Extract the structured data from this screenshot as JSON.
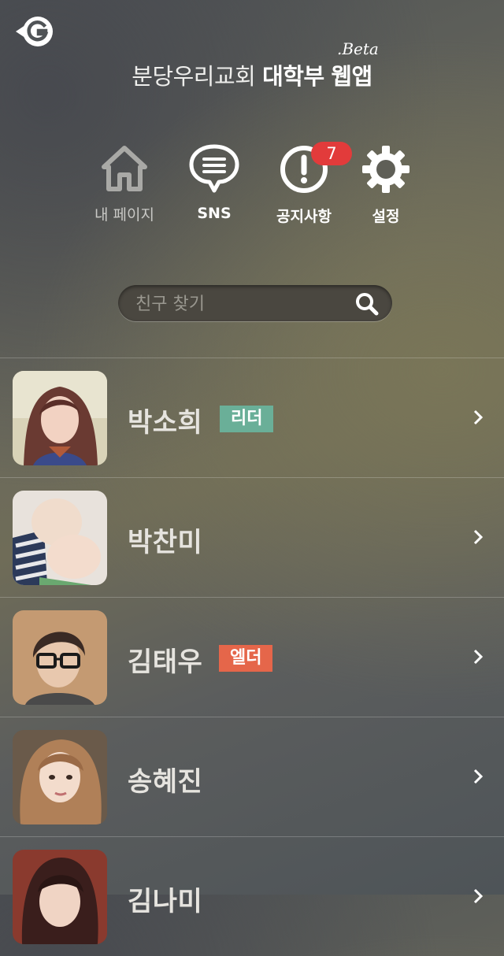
{
  "header": {
    "title_light": "분당우리교회",
    "title_bold_1": "대학부",
    "title_bold_2": "웹앱",
    "beta": ".Beta"
  },
  "menu": [
    {
      "label": "내 페이지",
      "icon": "home-icon"
    },
    {
      "label": "SNS",
      "icon": "chat-bubble-icon"
    },
    {
      "label": "공지사항",
      "icon": "alert-icon",
      "badge": "7"
    },
    {
      "label": "설정",
      "icon": "gear-icon"
    }
  ],
  "search": {
    "placeholder": "친구 찾기",
    "value": ""
  },
  "members": [
    {
      "name": "박소희",
      "tag": "리더",
      "tag_color": "#6aaf98"
    },
    {
      "name": "박찬미",
      "tag": "",
      "tag_color": ""
    },
    {
      "name": "김태우",
      "tag": "엘더",
      "tag_color": "#e5664a"
    },
    {
      "name": "송혜진",
      "tag": "",
      "tag_color": ""
    },
    {
      "name": "김나미",
      "tag": "",
      "tag_color": ""
    }
  ],
  "colors": {
    "badge": "#e23b3b",
    "leader_tag": "#6aaf98",
    "elder_tag": "#e5664a"
  }
}
